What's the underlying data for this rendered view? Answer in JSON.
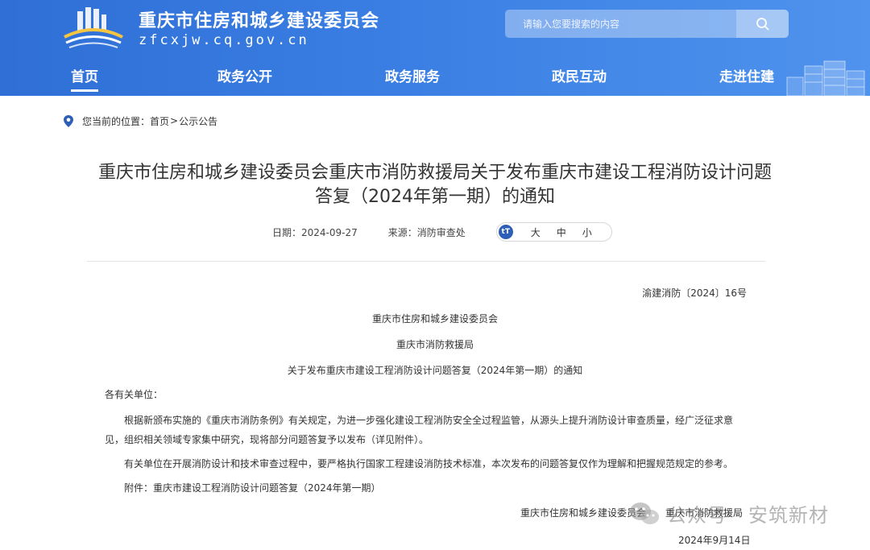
{
  "header": {
    "site_title": "重庆市住房和城乡建设委员会",
    "site_domain": "zfcxjw.cq.gov.cn",
    "search_placeholder": "请输入您要搜索的内容",
    "colors": {
      "header_blue": "#3a7ee3",
      "accent": "#2d5fb8"
    }
  },
  "nav": {
    "items": [
      {
        "label": "首页",
        "active": true
      },
      {
        "label": "政务公开"
      },
      {
        "label": "政务服务"
      },
      {
        "label": "政民互动"
      },
      {
        "label": "走进住建"
      }
    ]
  },
  "breadcrumb": {
    "prefix": "您当前的位置：",
    "home": "首页",
    "sep": ">",
    "current": "公示公告"
  },
  "article": {
    "title_line1": "重庆市住房和城乡建设委员会重庆市消防救援局关于发布重庆市建设工程消防设计问题",
    "title_line2": "答复（2024年第一期）的通知",
    "date_label": "日期：2024-09-27",
    "source_label": "来源：消防审查处",
    "fontsize": {
      "icon_text": "tT",
      "large": "大",
      "medium": "中",
      "small": "小"
    },
    "doc_no": "渝建消防〔2024〕16号",
    "issuer1": "重庆市住房和城乡建设委员会",
    "issuer2": "重庆市消防救援局",
    "subject": "关于发布重庆市建设工程消防设计问题答复（2024年第一期）的通知",
    "salutation": "各有关单位：",
    "para1": "根据新颁布实施的《重庆市消防条例》有关规定，为进一步强化建设工程消防安全全过程监管，从源头上提升消防设计审查质量，经广泛征求意见，组织相关领域专家集中研究，现将部分问题答复予以发布（详见附件）。",
    "para2": "有关单位在开展消防设计和技术审查过程中，要严格执行国家工程建设消防技术标准，本次发布的问题答复仅作为理解和把握规范规定的参考。",
    "attachment": "附件：重庆市建设工程消防设计问题答复（2024年第一期）",
    "sign_issuers": "重庆市住房和城乡建设委员会　　重庆市消防救援局",
    "sign_date": "2024年9月14日"
  },
  "watermark": {
    "text": "公众号 · 安筑新材"
  }
}
